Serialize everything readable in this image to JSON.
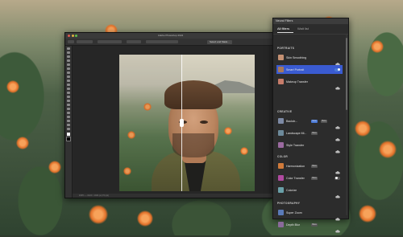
{
  "photoshop": {
    "window_title": "Adobe Photoshop 2024",
    "toolbar_ok": "Select and Mask...",
    "status_text": "100% — 1024 × 1024 px (72 ppi)"
  },
  "neural_filters": {
    "title": "Neural Filters",
    "tabs": [
      "All filters",
      "Wait list"
    ],
    "sections": [
      {
        "title": "PORTRAITS",
        "items": [
          {
            "label": "Skin Smoothing",
            "thumb": "#c59173",
            "control": "cloud"
          },
          {
            "label": "Smart Portrait",
            "thumb": "#a8795a",
            "control": "toggle-on",
            "selected": true
          },
          {
            "label": "Makeup Transfer",
            "thumb": "#c77c6a",
            "control": "cloud"
          }
        ]
      },
      {
        "title": "CREATIVE",
        "items": [
          {
            "label": "Backdr...",
            "thumb": "#7d8aa5",
            "control": "cloud",
            "badges": [
              "New",
              "Beta"
            ]
          },
          {
            "label": "Landscape Mi...",
            "thumb": "#6d8a9b",
            "control": "cloud",
            "badges": [
              "Beta"
            ]
          },
          {
            "label": "Style Transfer",
            "thumb": "#9b6aa0",
            "control": "cloud"
          }
        ]
      },
      {
        "title": "COLOR",
        "items": [
          {
            "label": "Harmonization",
            "thumb": "#d07a3a",
            "control": "cloud",
            "badges": [
              "Beta"
            ]
          },
          {
            "label": "Color Transfer",
            "thumb": "#b04aa0",
            "control": "toggle-off",
            "badges": [
              "Beta"
            ]
          },
          {
            "label": "Colorize",
            "thumb": "#6aa0a8",
            "control": "cloud"
          }
        ]
      },
      {
        "title": "PHOTOGRAPHY",
        "items": [
          {
            "label": "Super Zoom",
            "thumb": "#5a7ab8",
            "control": "cloud"
          },
          {
            "label": "Depth Blur",
            "thumb": "#8a6a9a",
            "control": "cloud",
            "badges": [
              "Beta"
            ]
          }
        ]
      }
    ]
  },
  "colors": {
    "accent": "#3a5bd1",
    "flower": "#e2712a",
    "cactus": "#3f5c3b"
  }
}
